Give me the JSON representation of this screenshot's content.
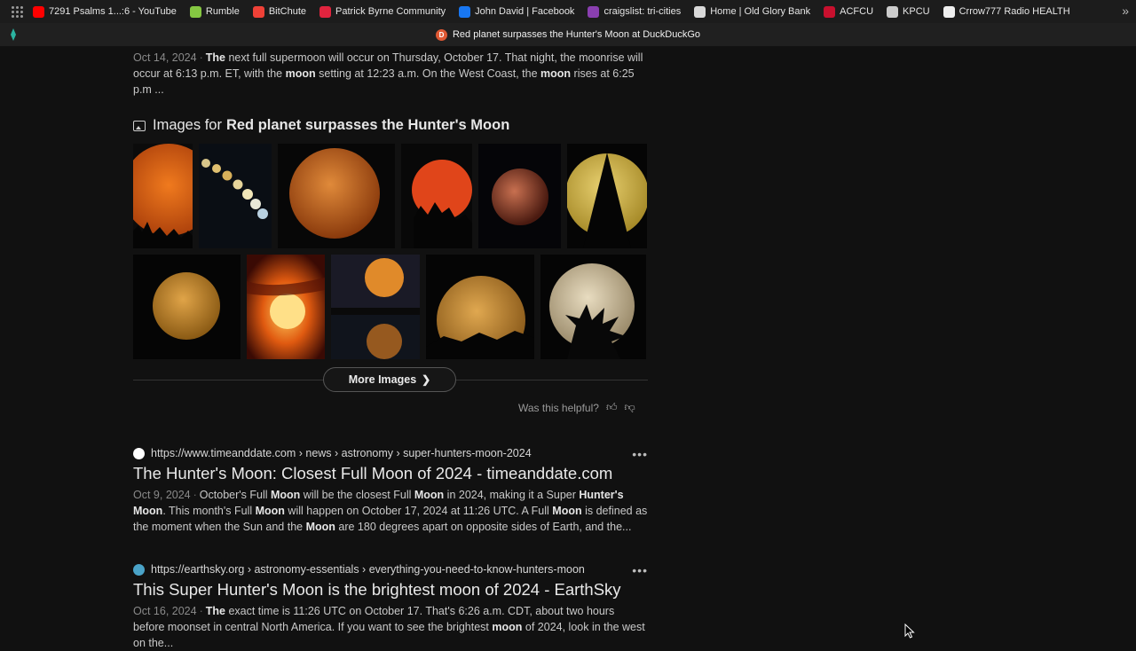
{
  "bookmarks": [
    {
      "label": "7291 Psalms 1...:6 - YouTube",
      "icon": "youtube-icon",
      "color": "#ff0000"
    },
    {
      "label": "Rumble",
      "icon": "rumble-icon",
      "color": "#85c742"
    },
    {
      "label": "BitChute",
      "icon": "bitchute-icon",
      "color": "#ef4137"
    },
    {
      "label": "Patrick Byrne Community",
      "icon": "community-icon",
      "color": "#e0243e"
    },
    {
      "label": "John David | Facebook",
      "icon": "facebook-icon",
      "color": "#1877f2"
    },
    {
      "label": "craigslist: tri-cities",
      "icon": "craigslist-icon",
      "color": "#8a3fb0"
    },
    {
      "label": "Home | Old Glory Bank",
      "icon": "bank-icon",
      "color": "#d9d9d9"
    },
    {
      "label": "ACFCU",
      "icon": "acfcu-icon",
      "color": "#c8102e"
    },
    {
      "label": "KPCU",
      "icon": "kpcu-icon",
      "color": "#cccccc"
    },
    {
      "label": "Crrow777 Radio HEALTH",
      "icon": "crrow-icon",
      "color": "#eeeeee"
    }
  ],
  "tab": {
    "title": "Red planet surpasses the Hunter's Moon at DuckDuckGo"
  },
  "top_snippet": {
    "date": "Oct 14, 2024",
    "parts": [
      {
        "b": true,
        "t": "The"
      },
      {
        "b": false,
        "t": " next full supermoon will occur on Thursday, October 17. That night, the moonrise will occur at 6:13 p.m. ET, with the "
      },
      {
        "b": true,
        "t": "moon"
      },
      {
        "b": false,
        "t": " setting at 12:23 a.m. On the West Coast, the "
      },
      {
        "b": true,
        "t": "moon"
      },
      {
        "b": false,
        "t": " rises at 6:25 p.m ..."
      }
    ]
  },
  "images_section": {
    "prefix": "Images for",
    "query": "Red planet surpasses the Hunter's Moon"
  },
  "more_images": {
    "label": "More Images"
  },
  "helpful": {
    "label": "Was this helpful?"
  },
  "results": [
    {
      "url": "https://www.timeanddate.com › news › astronomy › super-hunters-moon-2024",
      "title": "The Hunter's Moon: Closest Full Moon of 2024 - timeanddate.com",
      "date": "Oct 9, 2024",
      "fav_color": "#ffffff",
      "parts": [
        {
          "b": false,
          "t": "October's Full "
        },
        {
          "b": true,
          "t": "Moon"
        },
        {
          "b": false,
          "t": " will be the closest Full "
        },
        {
          "b": true,
          "t": "Moon"
        },
        {
          "b": false,
          "t": " in 2024, making it a Super "
        },
        {
          "b": true,
          "t": "Hunter's Moon"
        },
        {
          "b": false,
          "t": ". This month's Full "
        },
        {
          "b": true,
          "t": "Moon"
        },
        {
          "b": false,
          "t": " will happen on October 17, 2024 at 11:26 UTC. A Full "
        },
        {
          "b": true,
          "t": "Moon"
        },
        {
          "b": false,
          "t": " is defined as the moment when the Sun and the "
        },
        {
          "b": true,
          "t": "Moon"
        },
        {
          "b": false,
          "t": " are 180 degrees apart on opposite sides of Earth, and the..."
        }
      ]
    },
    {
      "url": "https://earthsky.org › astronomy-essentials › everything-you-need-to-know-hunters-moon",
      "title": "This Super Hunter's Moon is the brightest moon of 2024 - EarthSky",
      "date": "Oct 16, 2024",
      "fav_color": "#4aa3c8",
      "parts": [
        {
          "b": true,
          "t": "The"
        },
        {
          "b": false,
          "t": " exact time is 11:26 UTC on October 17. That's 6:26 a.m. CDT, about two hours before moonset in central North America. If you want to see the brightest "
        },
        {
          "b": true,
          "t": "moon"
        },
        {
          "b": false,
          "t": " of 2024, look in the west on the..."
        }
      ]
    }
  ]
}
